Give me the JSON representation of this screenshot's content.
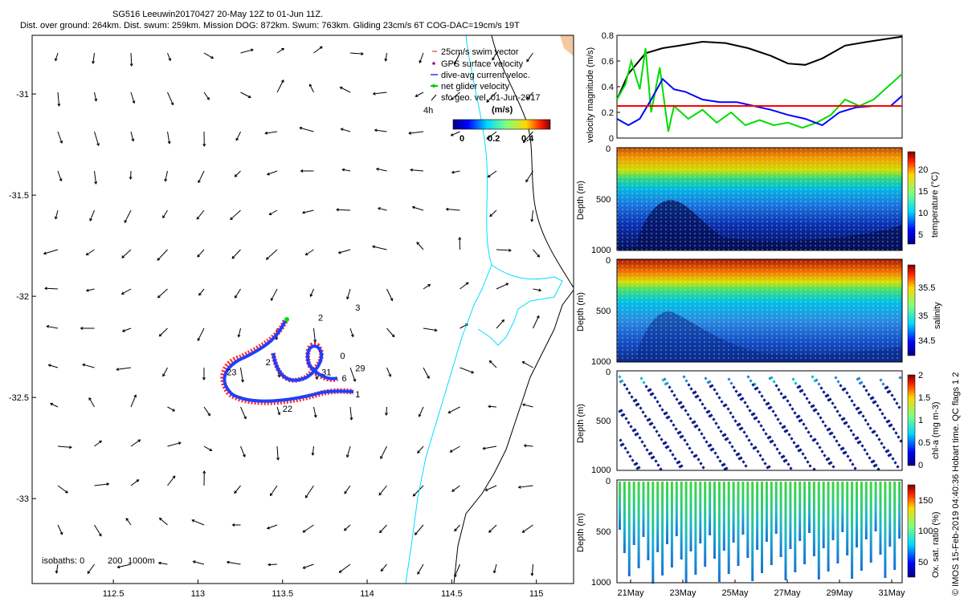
{
  "header": {
    "title": "SG516 Leeuwin20170427 20-May 12Z to 01-Jun 11Z.",
    "subtitle": "Dist. over ground: 264km. Dist. swum: 259km. Mission DOG: 872km. Swum: 763km. Gliding 23cm/s 6T COG-DAC=19cm/s 19T"
  },
  "map": {
    "lon_ticks": [
      "112.5",
      "113",
      "113.5",
      "114",
      "114.5",
      "115"
    ],
    "lat_ticks": [
      "-31",
      "-31.5",
      "-32",
      "-32.5",
      "-33"
    ],
    "lon_range": [
      112.02,
      115.22
    ],
    "lat_range": [
      -33.42,
      -30.71
    ],
    "legend": [
      {
        "label": "25cm/s swim vector",
        "color": "#ff0000"
      },
      {
        "label": "GPS surface velocity",
        "color": "#a000a0"
      },
      {
        "label": "dive-avg current veloc.",
        "color": "#0000ff"
      },
      {
        "label": "net glider velocity",
        "color": "#00cc00"
      },
      {
        "label": "sfc geo. vel. 01-Jun-2017",
        "color": "#000000"
      }
    ],
    "scale_note": "4h",
    "colorbar_unit": "(m/s)",
    "colorbar_ticks": [
      "0",
      "0.2",
      "0.4"
    ],
    "isobaths_label": "isobaths: 0",
    "isobath_values": [
      "200",
      "1000m"
    ],
    "day_labels": [
      {
        "text": "2",
        "lon": 113.71,
        "lat": -32.12
      },
      {
        "text": "3",
        "lon": 113.93,
        "lat": -32.07
      },
      {
        "text": "23",
        "lon": 113.17,
        "lat": -32.39
      },
      {
        "text": "2",
        "lon": 113.4,
        "lat": -32.34
      },
      {
        "text": "0",
        "lon": 113.84,
        "lat": -32.31
      },
      {
        "text": "29",
        "lon": 113.93,
        "lat": -32.37
      },
      {
        "text": "31",
        "lon": 113.73,
        "lat": -32.39
      },
      {
        "text": "6",
        "lon": 113.85,
        "lat": -32.42
      },
      {
        "text": "1",
        "lon": 113.93,
        "lat": -32.5
      },
      {
        "text": "22",
        "lon": 113.5,
        "lat": -32.57
      }
    ]
  },
  "chart_data": [
    {
      "type": "line",
      "ylabel": "velocity magnitude (m/s)",
      "ylim": [
        0,
        0.8
      ],
      "y_ticks": [
        "0",
        "0.2",
        "0.4",
        "0.6",
        "0.8"
      ],
      "series": [
        {
          "color": "#000000",
          "x": [
            0,
            0.04,
            0.1,
            0.16,
            0.22,
            0.3,
            0.38,
            0.46,
            0.54,
            0.6,
            0.66,
            0.72,
            0.8,
            0.88,
            0.94,
            1.0
          ],
          "values": [
            0.3,
            0.5,
            0.66,
            0.7,
            0.72,
            0.75,
            0.74,
            0.7,
            0.64,
            0.58,
            0.57,
            0.62,
            0.72,
            0.75,
            0.77,
            0.79
          ]
        },
        {
          "color": "#00dd00",
          "x": [
            0,
            0.03,
            0.05,
            0.08,
            0.1,
            0.12,
            0.15,
            0.18,
            0.2,
            0.25,
            0.3,
            0.35,
            0.4,
            0.45,
            0.5,
            0.55,
            0.6,
            0.65,
            0.7,
            0.75,
            0.8,
            0.85,
            0.9,
            0.95,
            1.0
          ],
          "values": [
            0.3,
            0.42,
            0.6,
            0.38,
            0.7,
            0.2,
            0.55,
            0.05,
            0.25,
            0.15,
            0.22,
            0.12,
            0.2,
            0.1,
            0.14,
            0.1,
            0.12,
            0.08,
            0.12,
            0.18,
            0.3,
            0.25,
            0.3,
            0.4,
            0.5
          ]
        },
        {
          "color": "#0000ff",
          "x": [
            0,
            0.04,
            0.08,
            0.12,
            0.16,
            0.2,
            0.24,
            0.3,
            0.36,
            0.42,
            0.48,
            0.54,
            0.6,
            0.66,
            0.72,
            0.78,
            0.84,
            0.9,
            0.96,
            1.0
          ],
          "values": [
            0.15,
            0.1,
            0.15,
            0.3,
            0.46,
            0.38,
            0.36,
            0.3,
            0.28,
            0.28,
            0.25,
            0.22,
            0.18,
            0.15,
            0.1,
            0.2,
            0.24,
            0.25,
            0.25,
            0.33
          ]
        },
        {
          "color": "#ff0000",
          "x": [
            0,
            1.0
          ],
          "values": [
            0.25,
            0.25
          ]
        }
      ]
    },
    {
      "type": "heatmap",
      "ylabel": "Depth (m)",
      "y_ticks": [
        "0",
        "500",
        "1000"
      ],
      "colorbar_label": "temperature (°C)",
      "colorbar_ticks": [
        "5",
        "10",
        "15",
        "20"
      ],
      "clim": [
        3,
        23
      ]
    },
    {
      "type": "heatmap",
      "ylabel": "Depth (m)",
      "y_ticks": [
        "0",
        "500",
        "1000"
      ],
      "colorbar_label": "salinity",
      "colorbar_ticks": [
        "34.5",
        "35",
        "35.5"
      ],
      "clim": [
        34.3,
        35.9
      ]
    },
    {
      "type": "scatter",
      "ylabel": "Depth (m)",
      "y_ticks": [
        "0",
        "500",
        "1000"
      ],
      "colorbar_label": "chl-a (mg m-3)",
      "colorbar_ticks": [
        "0",
        "0.5",
        "1",
        "1.5",
        "2"
      ],
      "clim": [
        0,
        2
      ]
    },
    {
      "type": "scatter",
      "ylabel": "Depth (m)",
      "y_ticks": [
        "0",
        "500",
        "1000"
      ],
      "colorbar_label": "Ox. sat. ratio (%)",
      "colorbar_ticks": [
        "50",
        "100",
        "150"
      ],
      "clim": [
        25,
        175
      ]
    }
  ],
  "time_axis": {
    "labels": [
      "21May",
      "23May",
      "25May",
      "27May",
      "29May",
      "31May"
    ]
  },
  "footer": {
    "credit": "© IMOS 15-Feb-2019 04:40:36 Hobart time. QC flags 1  2"
  }
}
